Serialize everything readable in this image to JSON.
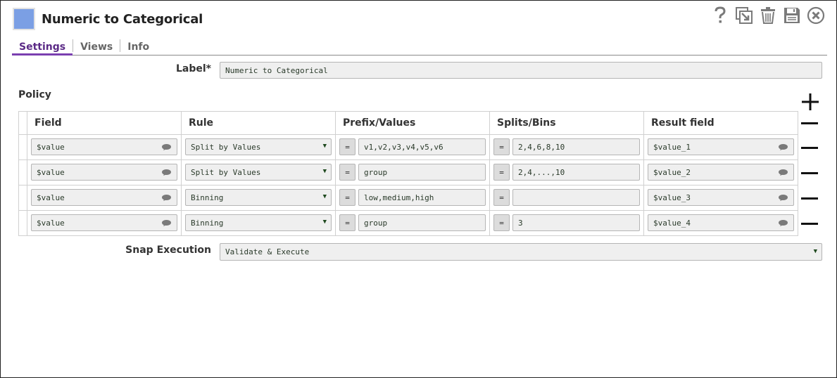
{
  "header": {
    "title": "Numeric to Categorical",
    "icon_color": "#7b9fe4",
    "toolbar": [
      {
        "name": "help-icon",
        "glyph": "?"
      },
      {
        "name": "export-icon",
        "glyph": "export"
      },
      {
        "name": "delete-icon",
        "glyph": "trash"
      },
      {
        "name": "save-icon",
        "glyph": "floppy"
      },
      {
        "name": "close-icon",
        "glyph": "x-circle"
      }
    ]
  },
  "tabs": [
    {
      "label": "Settings",
      "active": true
    },
    {
      "label": "Views",
      "active": false
    },
    {
      "label": "Info",
      "active": false
    }
  ],
  "form": {
    "label_label": "Label*",
    "label_value": "Numeric to Categorical",
    "policy_title": "Policy",
    "snap_execution_label": "Snap Execution",
    "snap_execution_value": "Validate & Execute"
  },
  "policy": {
    "columns": [
      "Field",
      "Rule",
      "Prefix/Values",
      "Splits/Bins",
      "Result field"
    ],
    "eq_label": "=",
    "rows": [
      {
        "field": "$value",
        "rule": "Split by Values",
        "prefix_values": "v1,v2,v3,v4,v5,v6",
        "splits_bins": "2,4,6,8,10",
        "result_field": "$value_1"
      },
      {
        "field": "$value",
        "rule": "Split by Values",
        "prefix_values": "group",
        "splits_bins": "2,4,...,10",
        "result_field": "$value_2"
      },
      {
        "field": "$value",
        "rule": "Binning",
        "prefix_values": "low,medium,high",
        "splits_bins": "",
        "result_field": "$value_3"
      },
      {
        "field": "$value",
        "rule": "Binning",
        "prefix_values": "group",
        "splits_bins": "3",
        "result_field": "$value_4"
      }
    ]
  },
  "colors": {
    "accent_tab": "#7a3fb0",
    "active_tab_text": "#5b2a86"
  }
}
